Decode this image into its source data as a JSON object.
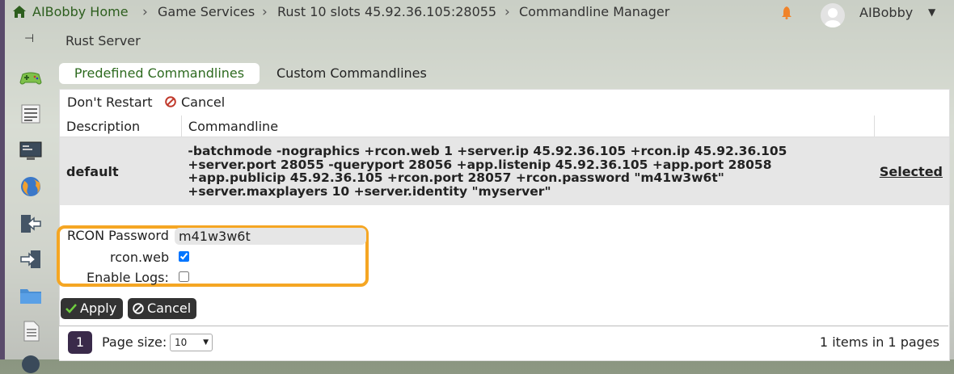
{
  "breadcrumb": {
    "home": "AIBobby Home",
    "items": [
      "Game Services",
      "Rust 10 slots 45.92.36.105:28055",
      "Commandline Manager"
    ]
  },
  "user": {
    "name": "AIBobby"
  },
  "section_title": "Rust Server",
  "tabs": [
    {
      "label": "Predefined Commandlines",
      "active": true
    },
    {
      "label": "Custom Commandlines",
      "active": false
    }
  ],
  "toolbar": {
    "dont_restart": "Don't Restart",
    "cancel": "Cancel"
  },
  "table": {
    "headers": [
      "Description",
      "Commandline"
    ],
    "rows": [
      {
        "description": "default",
        "commandline": "-batchmode -nographics +rcon.web 1 +server.ip 45.92.36.105 +rcon.ip 45.92.36.105 +server.port 28055 -queryport 28056 +app.listenip 45.92.36.105 +app.port 28058 +app.publicip 45.92.36.105 +rcon.port 28057 +rcon.password \"m41w3w6t\" +server.maxplayers 10 +server.identity \"myserver\"",
        "action": "Selected"
      }
    ]
  },
  "form": {
    "rcon_password_label": "RCON Password",
    "rcon_password_value": "m41w3w6t",
    "rcon_web_label": "rcon.web",
    "rcon_web_checked": true,
    "enable_logs_label": "Enable Logs:",
    "enable_logs_checked": false
  },
  "buttons": {
    "apply": "Apply",
    "cancel": "Cancel"
  },
  "pager": {
    "page": "1",
    "page_size_label": "Page size:",
    "page_size": "10",
    "summary": "1 items in 1 pages"
  },
  "colors": {
    "accent_green": "#2d6a1f",
    "highlight_orange": "#f5a623",
    "button_dark": "#333333"
  }
}
